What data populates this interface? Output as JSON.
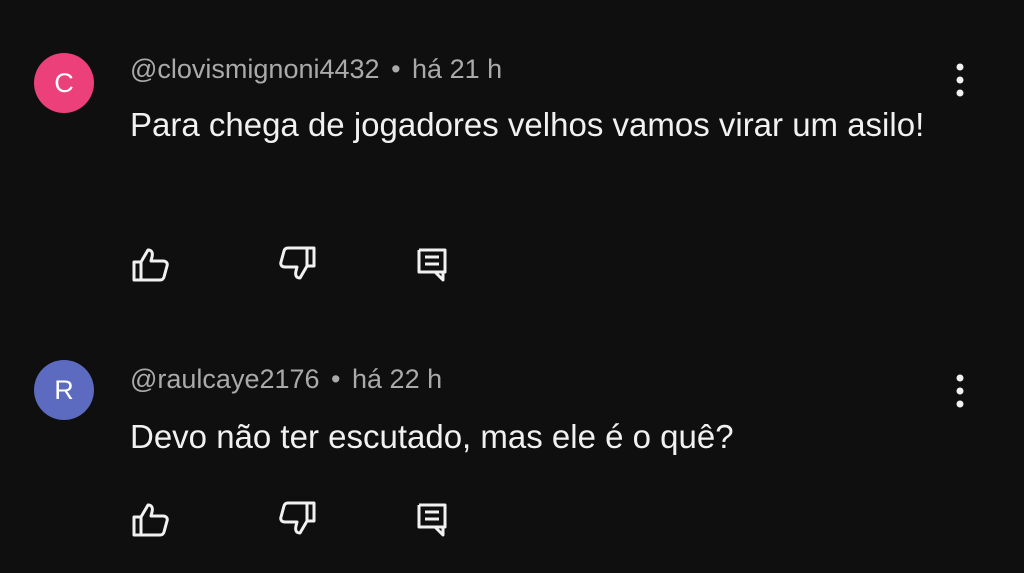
{
  "colors": {
    "background": "#0f0f0f",
    "text_primary": "#f1f1f1",
    "text_secondary": "#aaaaaa"
  },
  "comments": [
    {
      "avatar_letter": "C",
      "avatar_color": "#ec407a",
      "handle": "@clovismignoni4432",
      "separator": "•",
      "time": "há 21 h",
      "text": "Para chega de jogadores velhos vamos virar um asilo!",
      "actions": [
        "like-icon",
        "dislike-icon",
        "reply-icon"
      ],
      "menu_icon": "more-vertical-icon"
    },
    {
      "avatar_letter": "R",
      "avatar_color": "#5c6bc0",
      "handle": "@raulcaye2176",
      "separator": "•",
      "time": "há 22 h",
      "text": "Devo não ter escutado, mas ele é o quê?",
      "actions": [
        "like-icon",
        "dislike-icon",
        "reply-icon"
      ],
      "menu_icon": "more-vertical-icon"
    }
  ]
}
